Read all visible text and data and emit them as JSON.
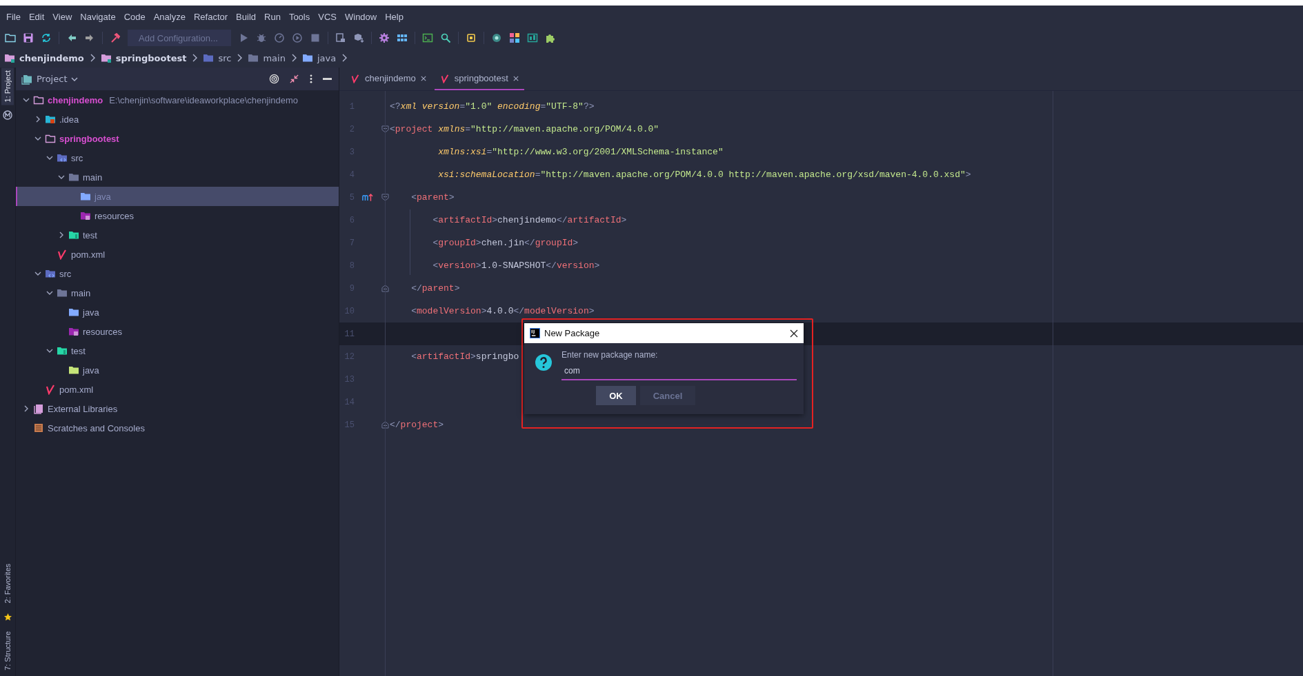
{
  "menu": [
    "File",
    "Edit",
    "View",
    "Navigate",
    "Code",
    "Analyze",
    "Refactor",
    "Build",
    "Run",
    "Tools",
    "VCS",
    "Window",
    "Help"
  ],
  "toolbar": {
    "run_configuration": "Add Configuration..."
  },
  "breadcrumb": [
    {
      "label": "chenjindemo",
      "kind": "module"
    },
    {
      "label": "springbootest",
      "kind": "module"
    },
    {
      "label": "src",
      "kind": "src"
    },
    {
      "label": "main",
      "kind": "folder"
    },
    {
      "label": "java",
      "kind": "java"
    }
  ],
  "tool_strip": {
    "top": [
      {
        "label": "1: Project",
        "selected": true
      }
    ],
    "bottom": [
      {
        "label": "2: Favorites",
        "selected": false
      },
      {
        "label": "7: Structure",
        "selected": false
      }
    ]
  },
  "project_panel": {
    "title": "Project",
    "tree": [
      {
        "label": "chenjindemo",
        "kind": "module",
        "path": "E:\\chenjin\\software\\ideaworkplace\\chenjindemo",
        "expanded": true,
        "selected": false,
        "children": [
          {
            "label": ".idea",
            "kind": "idea",
            "expanded": false,
            "selected": false
          },
          {
            "label": "springbootest",
            "kind": "module",
            "expanded": true,
            "selected": false,
            "children": [
              {
                "label": "src",
                "kind": "src",
                "expanded": true,
                "selected": false,
                "children": [
                  {
                    "label": "main",
                    "kind": "folder",
                    "expanded": true,
                    "selected": false,
                    "children": [
                      {
                        "label": "java",
                        "kind": "java",
                        "selected": true
                      },
                      {
                        "label": "resources",
                        "kind": "resources",
                        "selected": false
                      }
                    ]
                  },
                  {
                    "label": "test",
                    "kind": "test",
                    "expanded": false,
                    "selected": false
                  }
                ]
              },
              {
                "label": "pom.xml",
                "kind": "maven",
                "selected": false
              }
            ]
          },
          {
            "label": "src",
            "kind": "src",
            "expanded": true,
            "selected": false,
            "children": [
              {
                "label": "main",
                "kind": "folder",
                "expanded": true,
                "selected": false,
                "children": [
                  {
                    "label": "java",
                    "kind": "java",
                    "selected": false
                  },
                  {
                    "label": "resources",
                    "kind": "resources",
                    "selected": false
                  }
                ]
              },
              {
                "label": "test",
                "kind": "test",
                "expanded": true,
                "selected": false,
                "children": [
                  {
                    "label": "java",
                    "kind": "test-java",
                    "selected": false
                  }
                ]
              }
            ]
          },
          {
            "label": "pom.xml",
            "kind": "maven",
            "selected": false
          }
        ]
      },
      {
        "label": "External Libraries",
        "kind": "library",
        "expanded": false,
        "selected": false
      },
      {
        "label": "Scratches and Consoles",
        "kind": "scratches",
        "selected": false
      }
    ]
  },
  "editor": {
    "tabs": [
      {
        "label": "chenjindemo",
        "selected": false
      },
      {
        "label": "springbootest",
        "selected": true
      }
    ],
    "lines": [
      {
        "number": "1",
        "current": false,
        "fold_open": false,
        "fold_close": false,
        "override": false,
        "tokens": [
          {
            "kind": "punct",
            "text": "<?"
          },
          {
            "kind": "attr",
            "text": "xml version"
          },
          {
            "kind": "punct",
            "text": "="
          },
          {
            "kind": "value",
            "text": "\"1.0\""
          },
          {
            "kind": "attr",
            "text": " encoding"
          },
          {
            "kind": "punct",
            "text": "="
          },
          {
            "kind": "value",
            "text": "\"UTF-8\""
          },
          {
            "kind": "punct",
            "text": "?>"
          }
        ]
      },
      {
        "number": "2",
        "current": false,
        "fold_open": true,
        "fold_close": false,
        "override": false,
        "tokens": [
          {
            "kind": "punct",
            "text": "<"
          },
          {
            "kind": "tag",
            "text": "project"
          },
          {
            "kind": "attr",
            "text": " xmlns"
          },
          {
            "kind": "punct",
            "text": "="
          },
          {
            "kind": "value",
            "text": "\"http://maven.apache.org/POM/4.0.0\""
          }
        ]
      },
      {
        "number": "3",
        "current": false,
        "fold_open": false,
        "fold_close": false,
        "override": false,
        "tokens": [
          {
            "kind": "attr",
            "text": "         xmlns:xsi"
          },
          {
            "kind": "punct",
            "text": "="
          },
          {
            "kind": "value",
            "text": "\"http://www.w3.org/2001/XMLSchema-instance\""
          }
        ]
      },
      {
        "number": "4",
        "current": false,
        "fold_open": false,
        "fold_close": false,
        "override": false,
        "tokens": [
          {
            "kind": "attr",
            "text": "         xsi:schemaLocation"
          },
          {
            "kind": "punct",
            "text": "="
          },
          {
            "kind": "value",
            "text": "\"http://maven.apache.org/POM/4.0.0 http://maven.apache.org/xsd/maven-4.0.0.xsd\""
          },
          {
            "kind": "punct",
            "text": ">"
          }
        ]
      },
      {
        "number": "5",
        "current": false,
        "fold_open": true,
        "fold_close": false,
        "override": true,
        "tokens": [
          {
            "kind": "punct",
            "text": "    <"
          },
          {
            "kind": "tag",
            "text": "parent"
          },
          {
            "kind": "punct",
            "text": ">"
          }
        ]
      },
      {
        "number": "6",
        "current": false,
        "fold_open": false,
        "fold_close": false,
        "override": false,
        "tokens": [
          {
            "kind": "punct",
            "text": "        <"
          },
          {
            "kind": "tag",
            "text": "artifactId"
          },
          {
            "kind": "punct",
            "text": ">"
          },
          {
            "kind": "text",
            "text": "chenjindemo"
          },
          {
            "kind": "punct",
            "text": "</"
          },
          {
            "kind": "tag",
            "text": "artifactId"
          },
          {
            "kind": "punct",
            "text": ">"
          }
        ]
      },
      {
        "number": "7",
        "current": false,
        "fold_open": false,
        "fold_close": false,
        "override": false,
        "tokens": [
          {
            "kind": "punct",
            "text": "        <"
          },
          {
            "kind": "tag",
            "text": "groupId"
          },
          {
            "kind": "punct",
            "text": ">"
          },
          {
            "kind": "text",
            "text": "chen.jin"
          },
          {
            "kind": "punct",
            "text": "</"
          },
          {
            "kind": "tag",
            "text": "groupId"
          },
          {
            "kind": "punct",
            "text": ">"
          }
        ]
      },
      {
        "number": "8",
        "current": false,
        "fold_open": false,
        "fold_close": false,
        "override": false,
        "tokens": [
          {
            "kind": "punct",
            "text": "        <"
          },
          {
            "kind": "tag",
            "text": "version"
          },
          {
            "kind": "punct",
            "text": ">"
          },
          {
            "kind": "text",
            "text": "1.0-SNAPSHOT"
          },
          {
            "kind": "punct",
            "text": "</"
          },
          {
            "kind": "tag",
            "text": "version"
          },
          {
            "kind": "punct",
            "text": ">"
          }
        ]
      },
      {
        "number": "9",
        "current": false,
        "fold_open": false,
        "fold_close": true,
        "override": false,
        "tokens": [
          {
            "kind": "punct",
            "text": "    </"
          },
          {
            "kind": "tag",
            "text": "parent"
          },
          {
            "kind": "punct",
            "text": ">"
          }
        ]
      },
      {
        "number": "10",
        "current": false,
        "fold_open": false,
        "fold_close": false,
        "override": false,
        "tokens": [
          {
            "kind": "punct",
            "text": "    <"
          },
          {
            "kind": "tag",
            "text": "modelVersion"
          },
          {
            "kind": "punct",
            "text": ">"
          },
          {
            "kind": "text",
            "text": "4.0.0"
          },
          {
            "kind": "punct",
            "text": "</"
          },
          {
            "kind": "tag",
            "text": "modelVersion"
          },
          {
            "kind": "punct",
            "text": ">"
          }
        ]
      },
      {
        "number": "11",
        "current": true,
        "fold_open": false,
        "fold_close": false,
        "override": false
      },
      {
        "number": "12",
        "current": false,
        "fold_open": false,
        "fold_close": false,
        "override": false,
        "tokens": [
          {
            "kind": "punct",
            "text": "    <"
          },
          {
            "kind": "tag",
            "text": "artifactId"
          },
          {
            "kind": "punct",
            "text": ">"
          },
          {
            "kind": "text",
            "text": "springbo"
          }
        ]
      },
      {
        "number": "13",
        "current": false,
        "fold_open": false,
        "fold_close": false,
        "override": false
      },
      {
        "number": "14",
        "current": false,
        "fold_open": false,
        "fold_close": false,
        "override": false
      },
      {
        "number": "15",
        "current": false,
        "fold_open": false,
        "fold_close": true,
        "override": false,
        "tokens": [
          {
            "kind": "punct",
            "text": "</"
          },
          {
            "kind": "tag",
            "text": "project"
          },
          {
            "kind": "punct",
            "text": ">"
          }
        ]
      }
    ]
  },
  "dialog": {
    "title": "New Package",
    "prompt": "Enter new package name:",
    "value": "com",
    "buttons": [
      {
        "label": "OK",
        "default": true
      },
      {
        "label": "Cancel",
        "default": false
      }
    ]
  }
}
